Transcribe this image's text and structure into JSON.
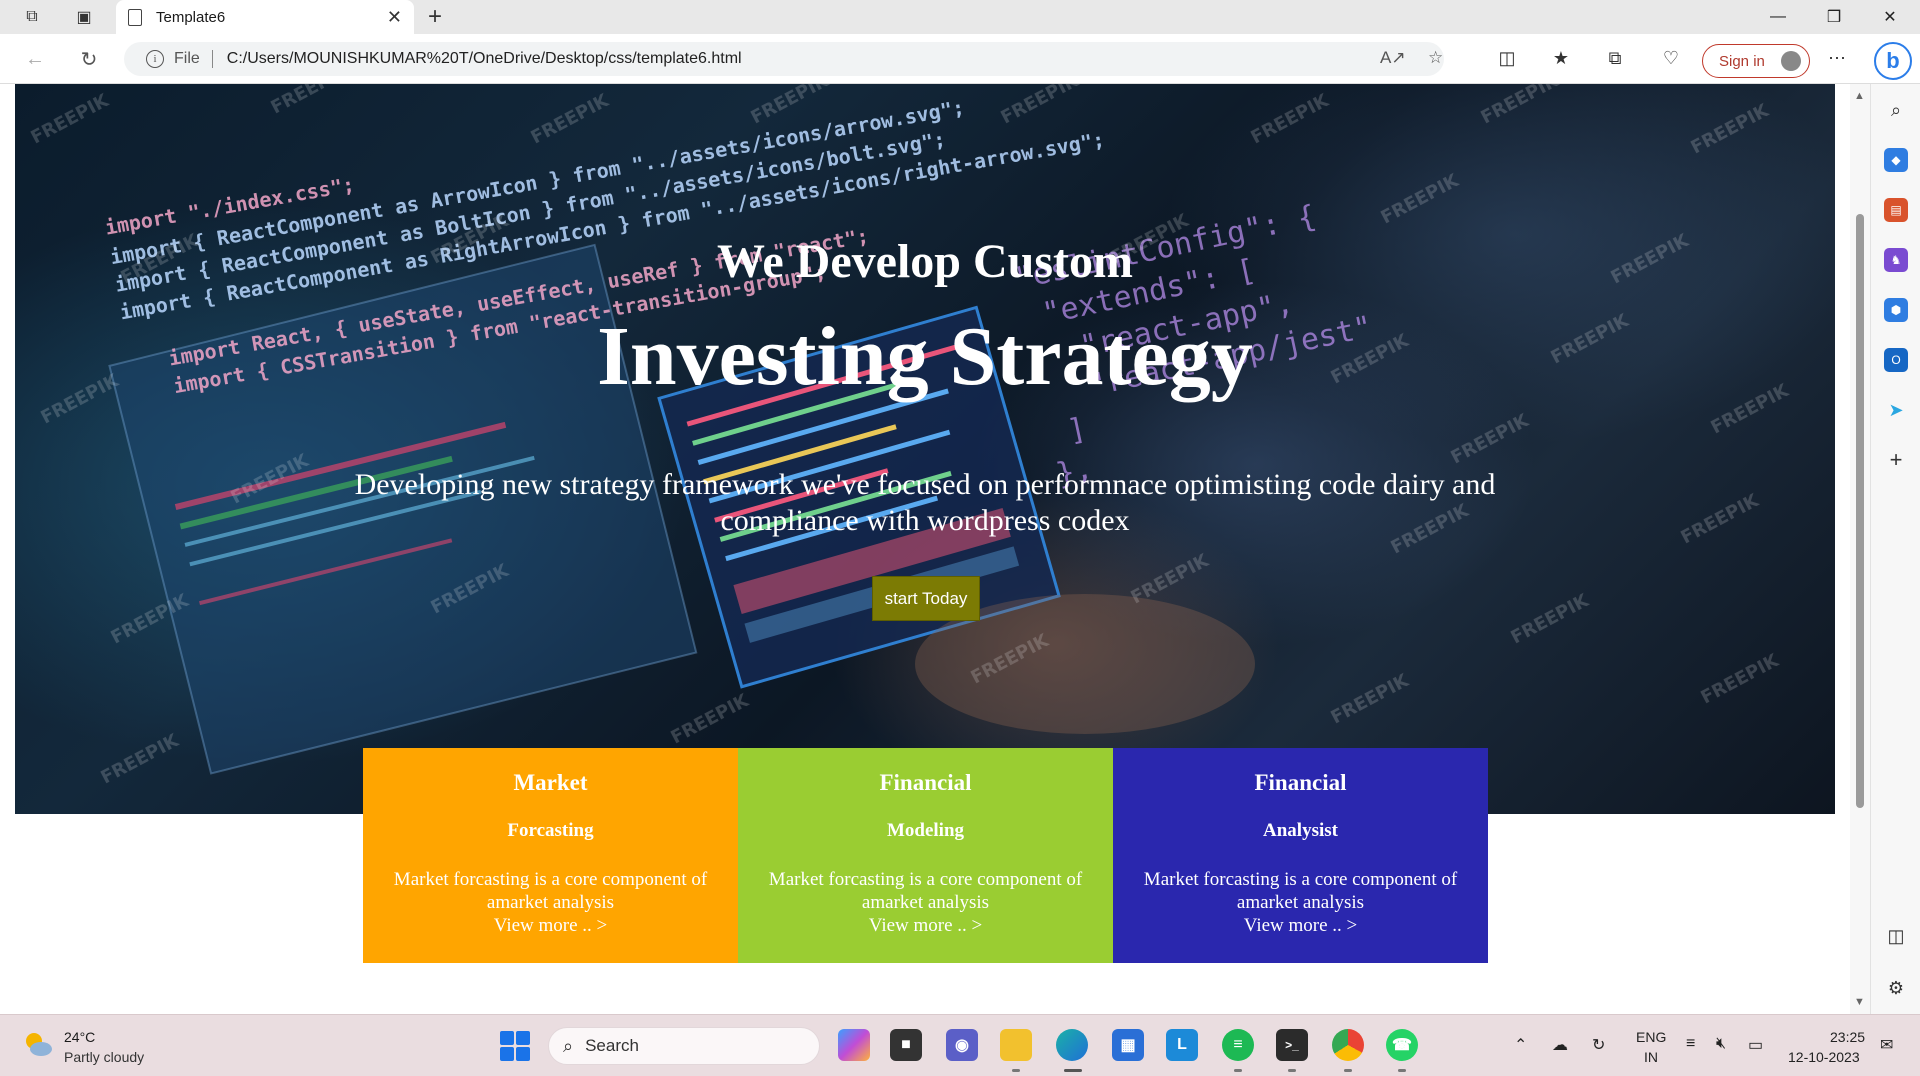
{
  "browser": {
    "tab_title": "Template6",
    "url_prefix": "File",
    "url": "C:/Users/MOUNISHKUMAR%20T/OneDrive/Desktop/css/template6.html",
    "signin_label": "Sign in",
    "icons": [
      "workspaces-icon",
      "tab-actions-icon",
      "back-icon",
      "refresh-icon",
      "read-aloud-icon",
      "favorite-star-icon",
      "split-screen-icon",
      "favorites-icon",
      "collections-icon",
      "browser-essentials-icon",
      "more-icon",
      "bing-copilot-icon"
    ]
  },
  "hero": {
    "title_line1": "We Develop Custom",
    "title_line2": "Investing Strategy",
    "description": "Developing new strategy framework we've focused on performnace optimisting code dairy and compliance with wordpress codex",
    "button_label": "start Today",
    "button_color": "#7c7b04",
    "watermark": "FREEPIK",
    "code_lines": [
      "import \"./index.css\";",
      "import { ReactComponent as ArrowIcon } from \"../assets/icons/arrow.svg\";",
      "import { ReactComponent as BoltIcon } from \"../assets/icons/bolt.svg\";",
      "import { ReactComponent as RightArrowIcon } from \"../assets/icons/right-arrow.svg\";",
      "import React, { useState, useEffect, useRef } from \"react\";",
      "import { CSSTransition } from \"react-transition-group\";"
    ],
    "code_lines_right": [
      "\"eslintConfig\": {",
      "\"extends\": [",
      "\"react-app\",",
      "\"react-app/jest\"",
      "]",
      "},"
    ]
  },
  "cards": [
    {
      "title": "Market",
      "subtitle": "Forcasting",
      "text": "Market forcasting is a core component of amarket analysis",
      "link": "View more .. >",
      "color": "#ffa500"
    },
    {
      "title": "Financial",
      "subtitle": "Modeling",
      "text": "Market forcasting is a core component of amarket analysis",
      "link": "View more .. >",
      "color": "#9acd32"
    },
    {
      "title": "Financial",
      "subtitle": "Analysist",
      "text": "Market forcasting is a core component of amarket analysis",
      "link": "View more .. >",
      "color": "#2a27ae"
    }
  ],
  "sidebar": {
    "icons": [
      "search-icon",
      "shopping-tag-icon",
      "tools-briefcase-icon",
      "games-icon",
      "microsoft-365-icon",
      "outlook-icon",
      "drop-send-icon",
      "add-icon",
      "sidebar-toggle-icon",
      "settings-gear-icon"
    ]
  },
  "taskbar": {
    "weather_temp": "24°C",
    "weather_condition": "Partly cloudy",
    "search_placeholder": "Search",
    "lang_line1": "ENG",
    "lang_line2": "IN",
    "time": "23:25",
    "date": "12-10-2023",
    "apps": [
      "copilot-app-icon",
      "file-explorer-window-icon",
      "teams-chat-icon",
      "file-explorer-icon",
      "edge-icon",
      "store-icon",
      "l-app-icon",
      "spotify-icon",
      "terminal-icon",
      "chrome-icon",
      "whatsapp-icon"
    ]
  }
}
